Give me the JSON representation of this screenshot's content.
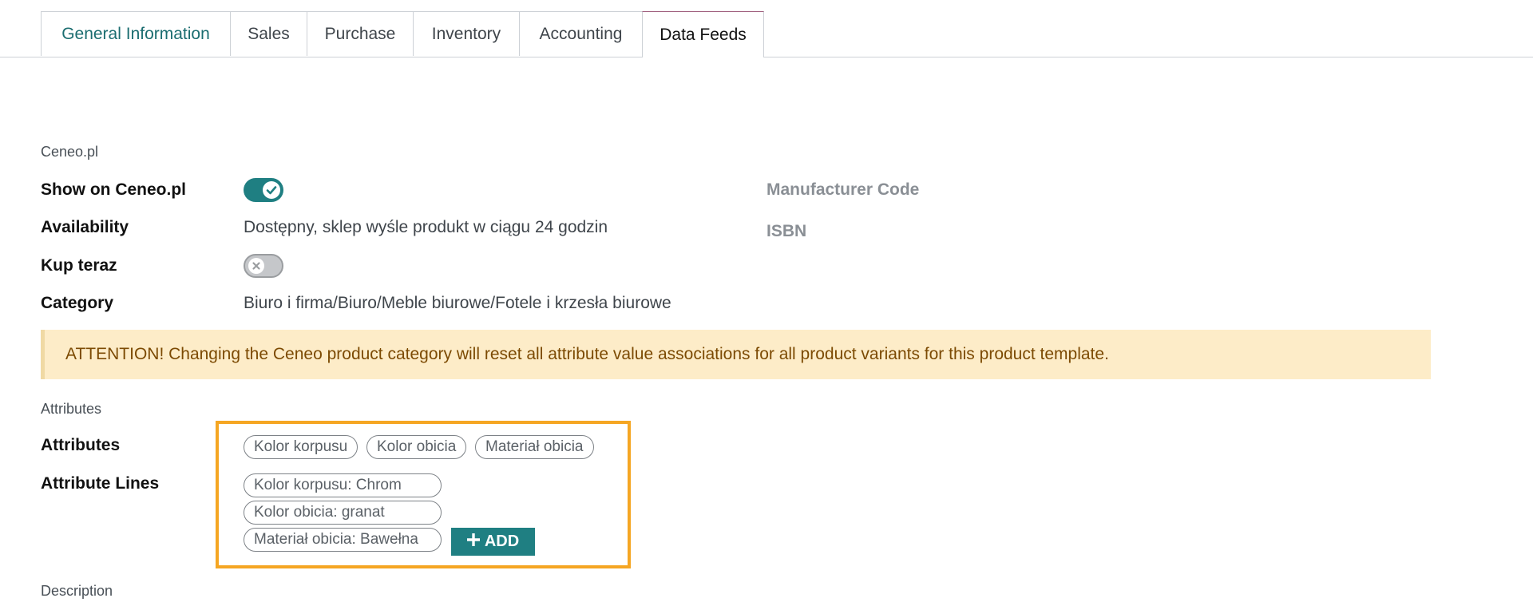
{
  "tabs": [
    {
      "label": "General Information"
    },
    {
      "label": "Sales"
    },
    {
      "label": "Purchase"
    },
    {
      "label": "Inventory"
    },
    {
      "label": "Accounting"
    },
    {
      "label": "Data Feeds"
    }
  ],
  "ceneo": {
    "section_title": "Ceneo.pl",
    "show_label": "Show on Ceneo.pl",
    "show_value": true,
    "availability_label": "Availability",
    "availability_value": "Dostępny, sklep wyśle produkt w ciągu 24 godzin",
    "kup_teraz_label": "Kup teraz",
    "kup_teraz_value": false,
    "category_label": "Category",
    "category_value": "Biuro i firma/Biuro/Meble biurowe/Fotele i krzesła biurowe",
    "manufacturer_code_label": "Manufacturer Code",
    "isbn_label": "ISBN"
  },
  "alert": {
    "text": "ATTENTION! Changing the Ceneo product category will reset all attribute value associations for all product variants for this product template."
  },
  "attributes": {
    "section_title": "Attributes",
    "attributes_label": "Attributes",
    "attribute_tags": [
      "Kolor korpusu",
      "Kolor obicia",
      "Materiał obicia"
    ],
    "lines_label": "Attribute Lines",
    "lines": [
      "Kolor korpusu: Chrom",
      "Kolor obicia: granat",
      "Materiał obicia: Bawełna"
    ],
    "add_label": "ADD"
  },
  "description": {
    "section_title": "Description"
  },
  "colors": {
    "accent": "#1f7f82",
    "alert_bg": "#fdecc8",
    "alert_text": "#7c4a03",
    "highlight": "#f5a623"
  },
  "icons": {
    "toggle_on": "check-icon",
    "toggle_off": "x-icon",
    "add": "plus-icon"
  }
}
